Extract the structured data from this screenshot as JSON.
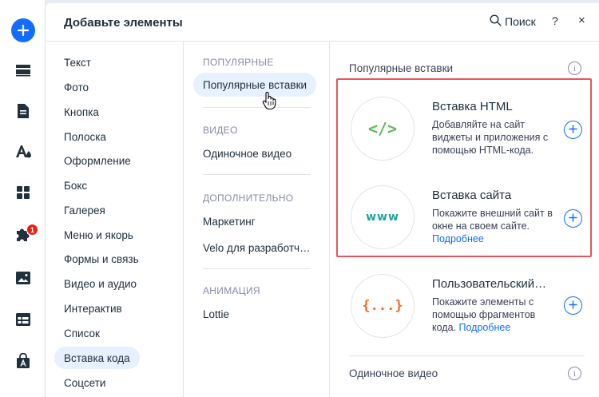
{
  "panel": {
    "title": "Добавьте элементы",
    "search_label": "Поиск",
    "help_label": "?",
    "close_label": "×"
  },
  "rail": {
    "items": [
      {
        "icon": "add-icon"
      },
      {
        "icon": "layout-strip-icon"
      },
      {
        "icon": "page-icon"
      },
      {
        "icon": "design-icon"
      },
      {
        "icon": "apps-grid-icon"
      },
      {
        "icon": "puzzle-icon",
        "badge": "1"
      },
      {
        "icon": "media-icon"
      },
      {
        "icon": "table-icon"
      },
      {
        "icon": "market-icon"
      }
    ]
  },
  "categories": [
    {
      "label": "Текст"
    },
    {
      "label": "Фото"
    },
    {
      "label": "Кнопка"
    },
    {
      "label": "Полоска"
    },
    {
      "label": "Оформление"
    },
    {
      "label": "Бокс"
    },
    {
      "label": "Галерея"
    },
    {
      "label": "Меню и якорь"
    },
    {
      "label": "Формы и связь"
    },
    {
      "label": "Видео и аудио"
    },
    {
      "label": "Интерактив"
    },
    {
      "label": "Список"
    },
    {
      "label": "Вставка кода",
      "active": true
    },
    {
      "label": "Соцсети"
    }
  ],
  "subcategories": {
    "popular_head": "ПОПУЛЯРНЫЕ",
    "popular_item": "Популярные вставки",
    "video_head": "ВИДЕО",
    "video_item": "Одиночное видео",
    "extra_head": "ДОПОЛНИТЕЛЬНО",
    "extra_item_1": "Маркетинг",
    "extra_item_2": "Velo для разработч…",
    "anim_head": "АНИМАЦИЯ",
    "anim_item": "Lottie"
  },
  "content": {
    "section_title": "Популярные вставки",
    "section2_title": "Одиночное видео",
    "cards": [
      {
        "icon_text": "</>",
        "icon_color": "#60bc57",
        "title": "Вставка HTML",
        "desc": "Добавляйте на сайт виджеты и приложения с помощью HTML-кода.",
        "link": ""
      },
      {
        "icon_text": "www",
        "icon_color": "#1fa5a0",
        "title": "Вставка сайта",
        "desc": "Покажите внешний сайт в окне на своем сайте.",
        "link": "Подробнее"
      },
      {
        "icon_text": "{...}",
        "icon_color": "#f26b2b",
        "title": "Пользовательский…",
        "desc": "Покажите элементы с помощью фрагментов кода.",
        "link": "Подробнее"
      }
    ]
  },
  "colors": {
    "accent": "#116dff",
    "highlight_border": "#e8545a",
    "active_bg": "#e7f0ff"
  }
}
